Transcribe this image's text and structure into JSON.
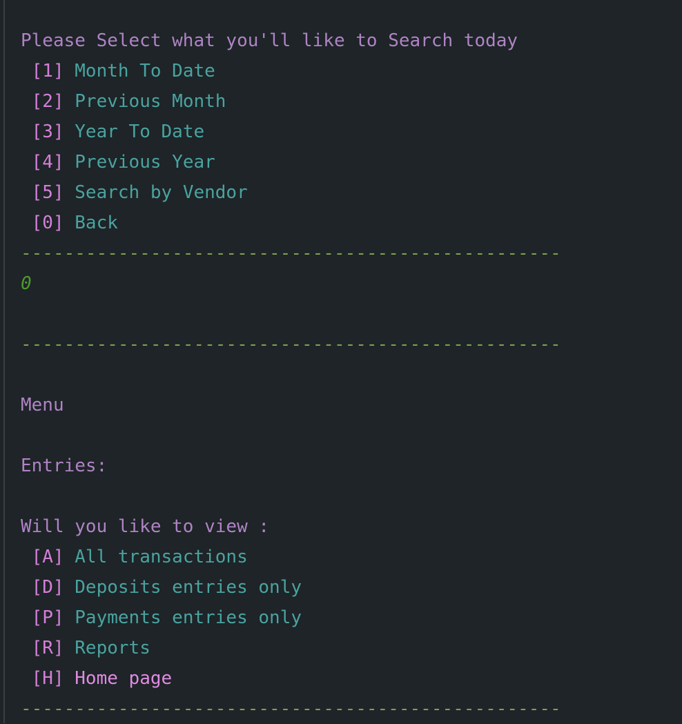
{
  "search_menu": {
    "prompt": "Please Select what you'll like to Search today",
    "options": [
      {
        "key": " [1] ",
        "label": "Month To Date"
      },
      {
        "key": " [2] ",
        "label": "Previous Month"
      },
      {
        "key": " [3] ",
        "label": "Year To Date"
      },
      {
        "key": " [4] ",
        "label": "Previous Year"
      },
      {
        "key": " [5] ",
        "label": "Search by Vendor"
      },
      {
        "key": " [0] ",
        "label": "Back"
      }
    ]
  },
  "separator": "--------------------------------------------------",
  "user_input": "0",
  "ledger_menu": {
    "title": "Menu",
    "entries_label": "Entries:",
    "prompt": "Will you like to view :",
    "options": [
      {
        "key": " [A] ",
        "label": "All transactions"
      },
      {
        "key": " [D] ",
        "label": "Deposits entries only"
      },
      {
        "key": " [P] ",
        "label": "Payments entries only"
      },
      {
        "key": " [R] ",
        "label": "Reports"
      },
      {
        "key": " [H] ",
        "label": "Home page"
      }
    ]
  }
}
